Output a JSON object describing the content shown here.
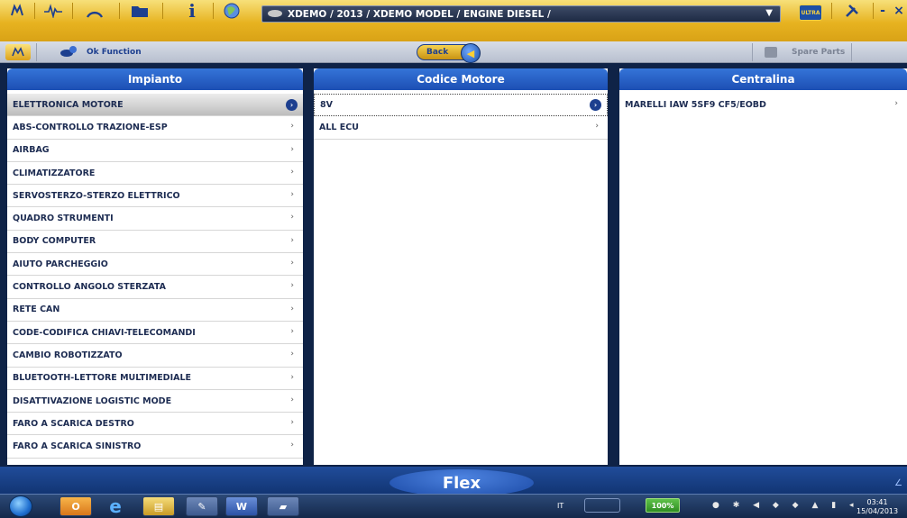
{
  "toolbar": {
    "icons": [
      "car-icon",
      "waveform-icon",
      "gauge-icon",
      "folder-icon",
      "info-icon",
      "globe-icon"
    ],
    "path": "XDEMO / 2013 / XDEMO MODEL / ENGINE DIESEL /",
    "brand_badge": "ULTRA",
    "right_icons": [
      "tools-icon",
      "minimize-icon",
      "close-icon"
    ]
  },
  "subbar": {
    "ok_function": "Ok Function",
    "back_label": "Back",
    "spare_parts": "Spare Parts"
  },
  "columns": {
    "impianto": {
      "title": "Impianto",
      "items": [
        "ELETTRONICA MOTORE",
        "ABS-CONTROLLO TRAZIONE-ESP",
        "AIRBAG",
        "CLIMATIZZATORE",
        "SERVOSTERZO-STERZO ELETTRICO",
        "QUADRO STRUMENTI",
        "BODY COMPUTER",
        "AIUTO PARCHEGGIO",
        "CONTROLLO ANGOLO STERZATA",
        "RETE CAN",
        "CODE-CODIFICA CHIAVI-TELECOMANDI",
        "CAMBIO ROBOTIZZATO",
        "BLUETOOTH-LETTORE MULTIMEDIALE",
        "DISATTIVAZIONE LOGISTIC MODE",
        "FARO A SCARICA DESTRO",
        "FARO A SCARICA SINISTRO"
      ],
      "selected_index": 0
    },
    "codice_motore": {
      "title": "Codice Motore",
      "items": [
        "8V",
        "ALL ECU"
      ],
      "selected_index": 0
    },
    "centralina": {
      "title": "Centralina",
      "items": [
        "MARELLI IAW 5SF9 CF5/EOBD"
      ]
    }
  },
  "bottom": {
    "flex_label": "Flex"
  },
  "taskbar": {
    "language": "IT",
    "battery": "100%",
    "time": "03:41",
    "date": "15/04/2013"
  }
}
